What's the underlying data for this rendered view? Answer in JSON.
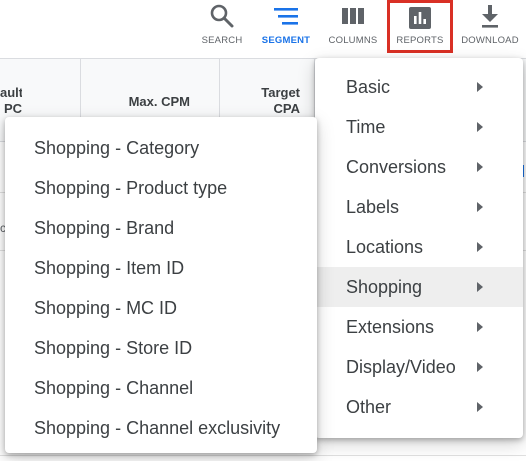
{
  "toolbar": {
    "search": "SEARCH",
    "segment": "SEGMENT",
    "columns": "COLUMNS",
    "reports": "REPORTS",
    "download": "DOWNLOAD"
  },
  "table": {
    "headers": {
      "default_cpc": "ault\nPC",
      "max_cpm": "Max. CPM",
      "target_cpa": "Target\nCPA"
    },
    "row_fragment": "c"
  },
  "reports_menu": {
    "items": [
      {
        "label": "Basic",
        "has_submenu": true
      },
      {
        "label": "Time",
        "has_submenu": true
      },
      {
        "label": "Conversions",
        "has_submenu": true
      },
      {
        "label": "Labels",
        "has_submenu": true
      },
      {
        "label": "Locations",
        "has_submenu": true
      },
      {
        "label": "Shopping",
        "has_submenu": true,
        "highlighted": true
      },
      {
        "label": "Extensions",
        "has_submenu": true
      },
      {
        "label": "Display/Video",
        "has_submenu": true
      },
      {
        "label": "Other",
        "has_submenu": true
      }
    ]
  },
  "shopping_submenu": {
    "items": [
      {
        "label": "Shopping - Category"
      },
      {
        "label": "Shopping - Product type"
      },
      {
        "label": "Shopping - Brand"
      },
      {
        "label": "Shopping - Item ID"
      },
      {
        "label": "Shopping - MC ID"
      },
      {
        "label": "Shopping - Store ID"
      },
      {
        "label": "Shopping - Channel"
      },
      {
        "label": "Shopping - Channel exclusivity"
      }
    ]
  },
  "colors": {
    "accent": "#1a73e8",
    "highlight_border": "#d93025",
    "icon_gray": "#5f6368"
  }
}
